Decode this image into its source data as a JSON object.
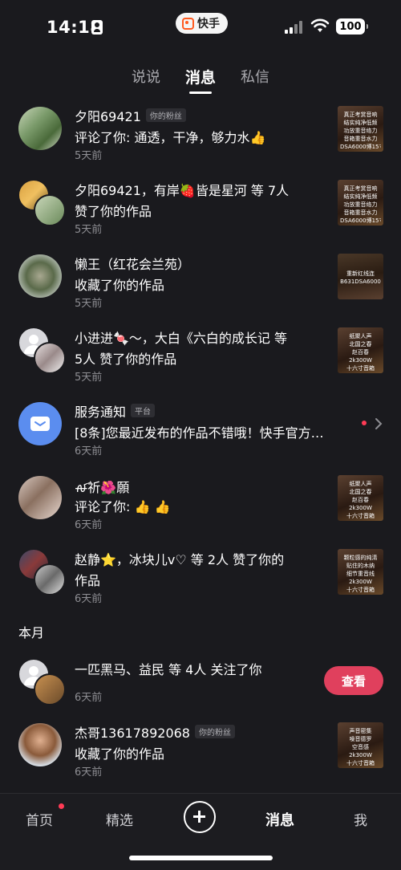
{
  "status_bar": {
    "time": "14:18",
    "app_pill": "快手",
    "battery": "100"
  },
  "top_tabs": [
    {
      "label": "说说"
    },
    {
      "label": "消息",
      "active": true
    },
    {
      "label": "私信"
    }
  ],
  "messages": [
    {
      "name": "夕阳69421",
      "badge": "你的粉丝",
      "action": "评论了你: 通透，干净，够力水👍",
      "time": "5天前",
      "thumb_caption": [
        "真正考赏音响",
        "结实纯净低频",
        "功放重音络力",
        "音箱重音水力",
        "DSA6000博15寸"
      ]
    },
    {
      "name": "夕阳69421，有岸🍓皆是星河 等 7人",
      "action": "赞了你的作品",
      "time": "5天前",
      "thumb_caption": [
        "真正考赏音响",
        "结实纯净低频",
        "功放重音络力",
        "音箱重音水力",
        "DSA6000博15寸"
      ]
    },
    {
      "name": "懒王（红花会兰苑）",
      "action": "收藏了你的作品",
      "time": "5天前",
      "thumb_caption": [
        "重新红线连",
        "B631DSA6000"
      ]
    },
    {
      "name": "小进进🍬～，大白《六白的成长记 等",
      "name2": "5人 赞了你的作品",
      "time": "5天前",
      "thumb_caption": [
        "纸聚人声",
        "北国之春",
        "赵百春",
        "2k300W",
        "十六寸音箱"
      ]
    },
    {
      "name": "服务通知",
      "badge": "平台",
      "action": "[8条]您最近发布的作品不错哦！快手官方…",
      "time": "6天前"
    },
    {
      "name": "ꫛ祈🌺願",
      "action": "评论了你: 👍 👍",
      "time": "6天前",
      "thumb_caption": [
        "纸聚人声",
        "北国之春",
        "赵百春",
        "2k300W",
        "十六寸音箱"
      ]
    },
    {
      "name": "赵静⭐，冰块儿v♡ 等 2人 赞了你的",
      "name2": "作品",
      "time": "6天前",
      "thumb_caption": [
        "颗粒感的纯清",
        "贴住的木纳",
        "细节重音线",
        "2k300W",
        "十六寸音箱"
      ]
    }
  ],
  "section_month": "本月",
  "follow_item": {
    "name": "一匹黑马、益民 等 4人 关注了你",
    "time": "6天前",
    "button": "查看"
  },
  "last_item": {
    "name": "杰哥13617892068",
    "badge": "你的粉丝",
    "action": "收藏了你的作品",
    "time": "6天前",
    "thumb_caption": [
      "声音密集",
      "噪音德罗",
      "空音感",
      "2k300W",
      "十六寸音箱"
    ]
  },
  "bottom_nav": [
    {
      "label": "首页"
    },
    {
      "label": "精选"
    },
    {
      "label": "消息",
      "active": true
    },
    {
      "label": "我"
    }
  ]
}
